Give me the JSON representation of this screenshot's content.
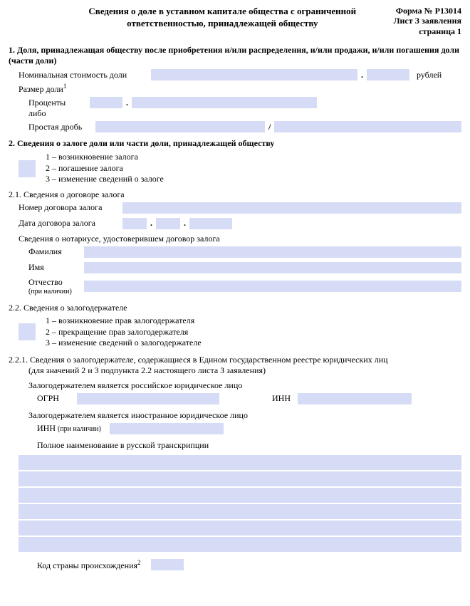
{
  "header": {
    "title_l1": "Сведения о доле в уставном капитале общества с ограниченной",
    "title_l2": "ответственностью, принадлежащей обществу",
    "form_no": "Форма № Р13014",
    "sheet": "Лист З заявления",
    "page": "страница 1"
  },
  "s1": {
    "head": "1. Доля, принадлежащая обществу после приобретения и/или распределения, и/или продажи, и/или погашения доли (части доли)",
    "nominal_label": "Номинальная стоимость доли",
    "rub": "рублей",
    "size_label": "Размер доли",
    "size_sup": "1",
    "percent_label": "Проценты",
    "or_label": "либо",
    "fraction_label": "Простая дробь"
  },
  "s2": {
    "head": "2. Сведения о залоге доли или части доли, принадлежащей обществу",
    "c1": "1 – возникновение залога",
    "c2": "2 – погашение залога",
    "c3": "3 – изменение сведений о залоге"
  },
  "s21": {
    "head": "2.1. Сведения о договоре залога",
    "num_label": "Номер договора залога",
    "date_label": "Дата договора залога",
    "notary_label": "Сведения о нотариусе, удостоверившем договор залога",
    "fam_label": "Фамилия",
    "name_label": "Имя",
    "patr_label": "Отчество",
    "patr_note": "(при наличии)"
  },
  "s22": {
    "head": "2.2. Сведения о залогодержателе",
    "c1": "1 – возникновение прав залогодержателя",
    "c2": "2 – прекращение прав залогодержателя",
    "c3": "3 – изменение сведений о залогодержателе"
  },
  "s221": {
    "head": "2.2.1. Сведения о залогодержателе, содержащиеся в Едином государственном реестре юридических лиц",
    "sub": "(для значений 2 и 3 подпункта 2.2 настоящего листа З заявления)",
    "ru_label": "Залогодержателем является российское юридическое лицо",
    "ogrn": "ОГРН",
    "inn": "ИНН",
    "for_label": "Залогодержателем является иностранное юридическое лицо",
    "inn2": "ИНН",
    "inn2_note": "(при наличии)",
    "fullname_label": "Полное наименование в русской транскрипции",
    "country_label": "Код страны происхождения",
    "country_sup": "2"
  }
}
